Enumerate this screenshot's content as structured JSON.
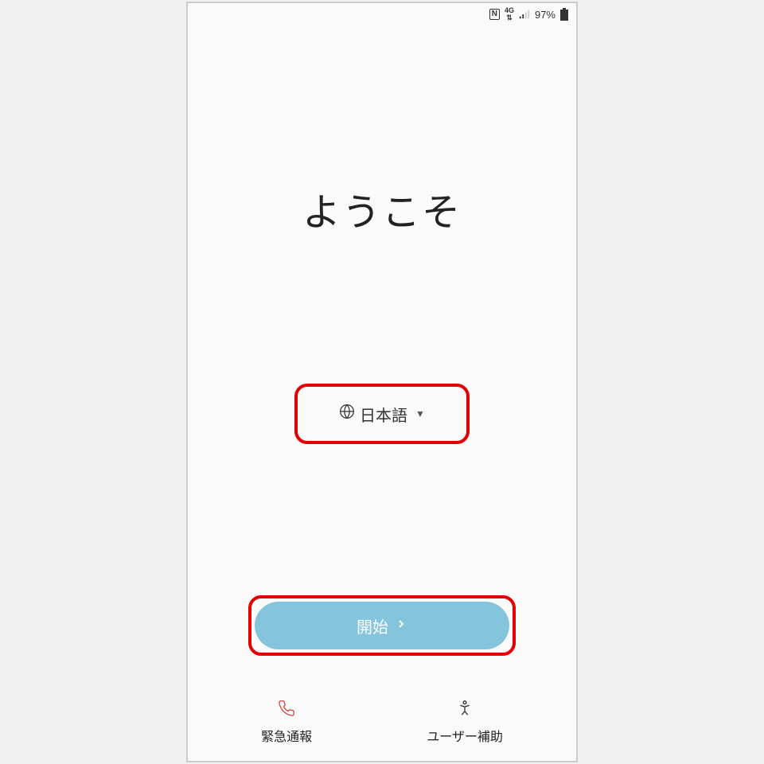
{
  "statusBar": {
    "nfc": "N",
    "network": "4G",
    "battery": "97%"
  },
  "welcome": {
    "title": "ようこそ"
  },
  "language": {
    "selected": "日本語"
  },
  "actions": {
    "startLabel": "開始"
  },
  "footer": {
    "emergency": "緊急通報",
    "accessibility": "ユーザー補助"
  }
}
